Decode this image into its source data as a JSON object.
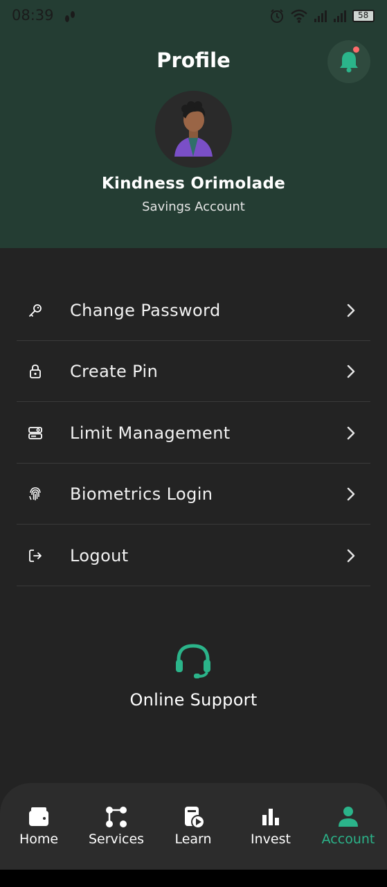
{
  "status_bar": {
    "time": "08:39",
    "battery": "58"
  },
  "header": {
    "title": "Profile",
    "user_name": "Kindness Orimolade",
    "account_type": "Savings Account"
  },
  "menu": {
    "items": [
      {
        "label": "Change Password",
        "icon": "key-icon"
      },
      {
        "label": "Create Pin",
        "icon": "lock-icon"
      },
      {
        "label": "Limit Management",
        "icon": "limit-icon"
      },
      {
        "label": "Biometrics Login",
        "icon": "fingerprint-icon"
      },
      {
        "label": "Logout",
        "icon": "logout-icon"
      }
    ]
  },
  "support": {
    "label": "Online Support",
    "icon": "headset-icon"
  },
  "bottom_nav": {
    "items": [
      {
        "label": "Home",
        "icon": "wallet-icon",
        "active": false
      },
      {
        "label": "Services",
        "icon": "services-icon",
        "active": false
      },
      {
        "label": "Learn",
        "icon": "learn-icon",
        "active": false
      },
      {
        "label": "Invest",
        "icon": "bar-chart-icon",
        "active": false
      },
      {
        "label": "Account",
        "icon": "user-icon",
        "active": true
      }
    ]
  },
  "colors": {
    "header_bg": "#243d33",
    "content_bg": "#232323",
    "accent": "#2bb48a",
    "notification_dot": "#ff6b6b"
  }
}
